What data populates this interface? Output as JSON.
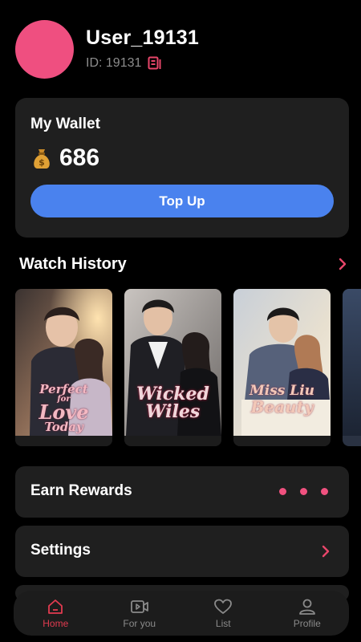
{
  "profile": {
    "username": "User_19131",
    "user_id_text": "ID: 19131",
    "avatar_color": "#ef4f80",
    "copy_icon": "copy-id-icon"
  },
  "wallet": {
    "title": "My Wallet",
    "coin_icon": "money-bag-icon",
    "balance": "686",
    "topup_label": "Top Up",
    "accent": "#4a82ee"
  },
  "watch_history": {
    "title": "Watch History",
    "items": [
      {
        "title_lines": [
          "Perfect",
          "for",
          "Love",
          "Today"
        ]
      },
      {
        "title_lines": [
          "Wicked",
          "Wiles"
        ]
      },
      {
        "title_lines": [
          "Miss Liu",
          "Beauty"
        ]
      }
    ]
  },
  "menu": {
    "earn_rewards": "Earn Rewards",
    "settings": "Settings"
  },
  "nav": {
    "items": [
      {
        "label": "Home",
        "icon": "home-icon",
        "active": true
      },
      {
        "label": "For you",
        "icon": "video-icon",
        "active": false
      },
      {
        "label": "List",
        "icon": "heart-icon",
        "active": false
      },
      {
        "label": "Profile",
        "icon": "profile-icon",
        "active": false
      }
    ],
    "active_color": "#e23b50"
  }
}
